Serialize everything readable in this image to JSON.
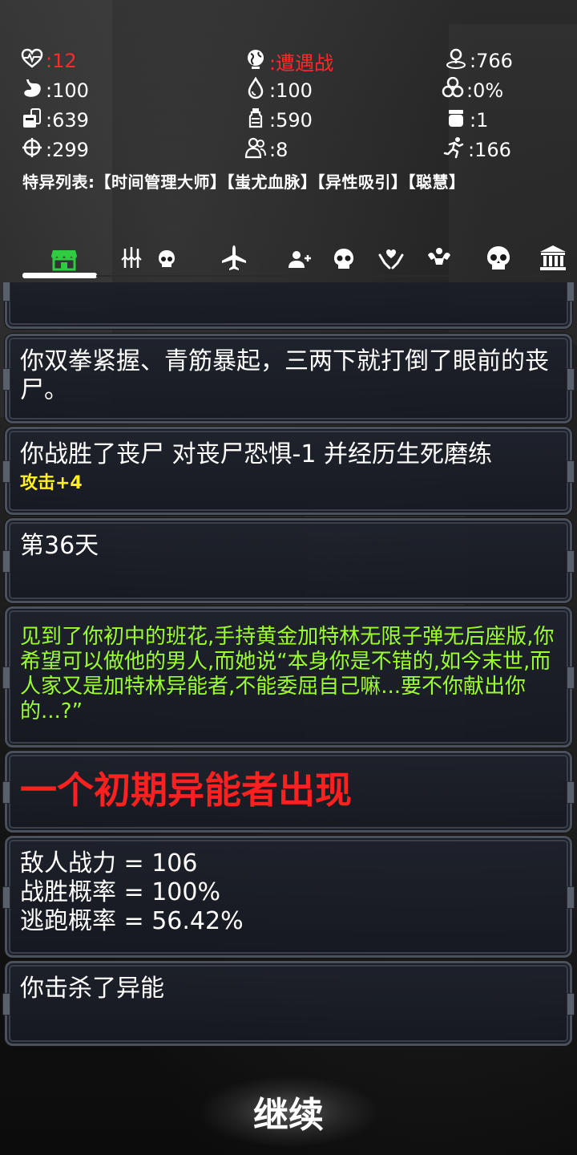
{
  "stats": {
    "health": ":12",
    "encounter": ":遭遇战",
    "location": ":766",
    "hunger": ":100",
    "water": ":100",
    "infection": ":0%",
    "food": ":639",
    "drink": ":590",
    "medkit": ":1",
    "attack": ":299",
    "team": ":8",
    "speed": ":166"
  },
  "traits": "特异列表:【时间管理大师】【蚩尤血脉】【异性吸引】【聪慧】",
  "tabs": [
    {
      "icon": "shop-icon",
      "active": true
    },
    {
      "icon": "weapons-icon"
    },
    {
      "icon": "skull-small-icon"
    },
    {
      "icon": "airplane-icon"
    },
    {
      "icon": "add-person-icon"
    },
    {
      "icon": "skull-icon"
    },
    {
      "icon": "heart-hands-icon"
    },
    {
      "icon": "muscle-icon"
    },
    {
      "icon": "skull-large-icon"
    },
    {
      "icon": "bank-icon"
    }
  ],
  "log": {
    "entry1": "你双拳紧握、青筋暴起，三两下就打倒了眼前的丧尸。",
    "entry2_main": "你战胜了丧尸 对丧尸恐惧-1 并经历生死磨练",
    "entry2_bonus": "攻击+4",
    "entry3": "第36天",
    "entry4": "见到了你初中的班花,手持黄金加特林无限子弹无后座版,你希望可以做他的男人,而她说“本身你是不错的,如今末世,而人家又是加特林异能者,不能委屈自己嘛...要不你献出你的...?”",
    "entry5": "一个初期异能者出现",
    "entry6_line1": "敌人战力 = 106",
    "entry6_line2": "战胜概率 = 100%",
    "entry6_line3": "逃跑概率 = 56.42%",
    "entry7": "你击杀了异能"
  },
  "continue_label": "继续",
  "colors": {
    "danger": "#ff2a2a",
    "green_text": "#9cff2e",
    "yellow_text": "#ffee22",
    "shop_active": "#2ecc40"
  }
}
